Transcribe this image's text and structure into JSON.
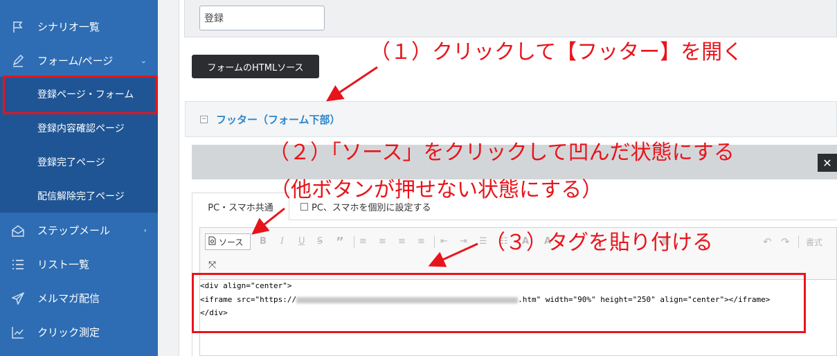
{
  "sidebar": {
    "items": [
      {
        "label": "シナリオ一覧",
        "icon": "flag-icon"
      },
      {
        "label": "フォーム/ページ",
        "icon": "pen-icon",
        "chevron": "⌄"
      },
      {
        "label": "ステップメール",
        "icon": "envelope-open-icon",
        "chevron": "‹"
      },
      {
        "label": "リスト一覧",
        "icon": "list-icon"
      },
      {
        "label": "メルマガ配信",
        "icon": "paper-plane-icon"
      },
      {
        "label": "クリック測定",
        "icon": "line-chart-icon"
      }
    ],
    "submenu": [
      {
        "label": "登録ページ・フォーム",
        "selected": true
      },
      {
        "label": "登録内容確認ページ"
      },
      {
        "label": "登録完了ページ"
      },
      {
        "label": "配信解除完了ページ"
      }
    ]
  },
  "form": {
    "register_value": "登録",
    "html_source_button": "フォームのHTMLソース"
  },
  "section": {
    "toggle": "−",
    "title": "フッター（フォーム下部）"
  },
  "tabs": {
    "common": "PC・スマホ共通",
    "separate": "PC、スマホを個別に設定する"
  },
  "toolbar": {
    "source_label": "ソース",
    "format_label": "書式",
    "close": "✕"
  },
  "code": {
    "line1": "<div align=\"center\">",
    "line2_prefix": "<iframe src=\"https://",
    "line2_suffix": ".htm\" width=\"90%\" height=\"250\" align=\"center\"></iframe>",
    "line3": "</div>"
  },
  "annotations": {
    "step1": "（１）クリックして【フッター】を開く",
    "step2": "（２）「ソース」をクリックして凹んだ状態にする",
    "step2b": "（他ボタンが押せない状態にする）",
    "step3": "（３）タグを貼り付ける"
  },
  "colors": {
    "sidebar": "#2e6db3",
    "submenu": "#1f5594",
    "annotation_red": "#e8141b",
    "section_title": "#2e86c9"
  }
}
